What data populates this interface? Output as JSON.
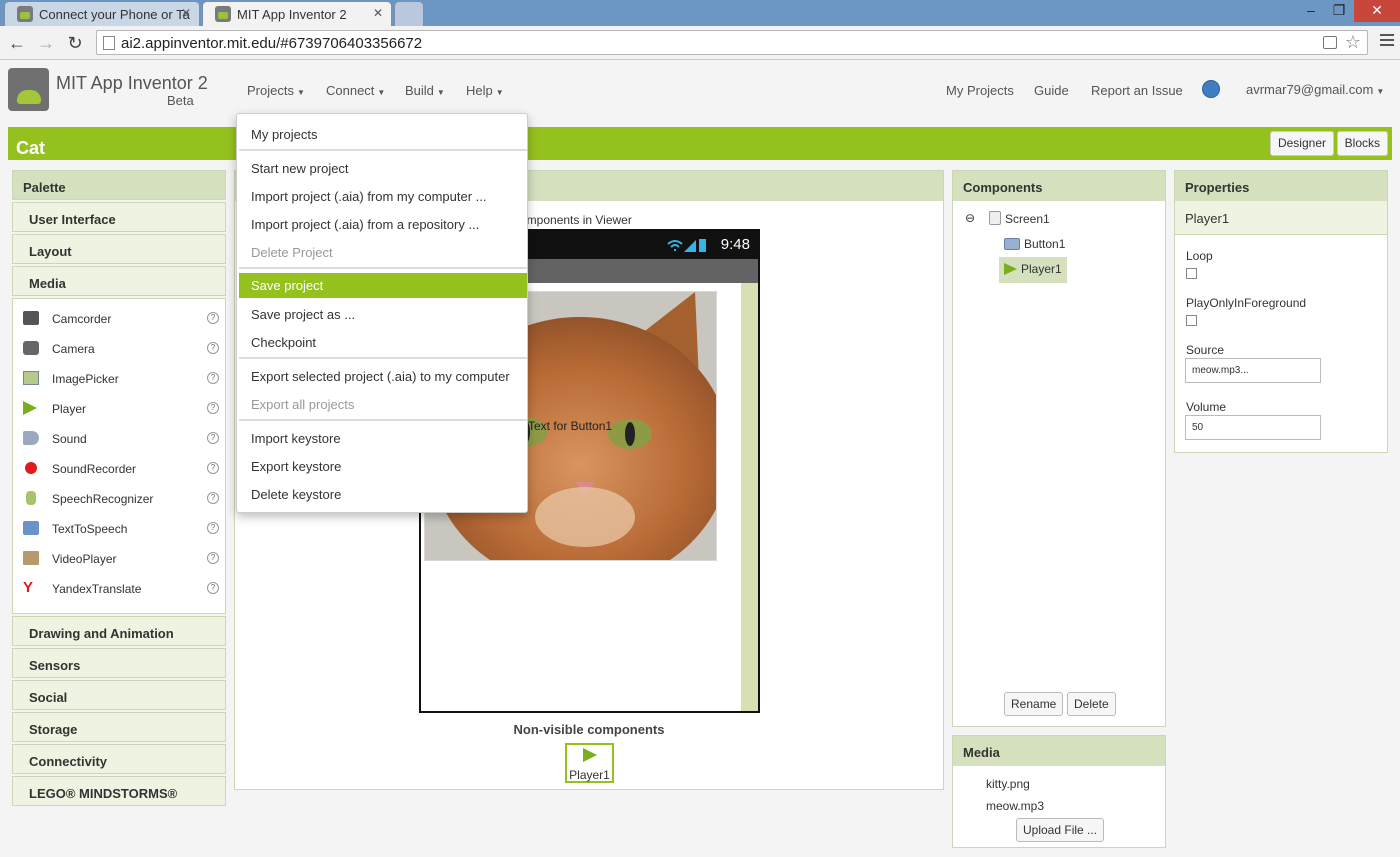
{
  "browser": {
    "tabs": [
      {
        "title": "Connect your Phone or Ta",
        "active": false
      },
      {
        "title": "MIT App Inventor 2",
        "active": true
      }
    ],
    "url": "ai2.appinventor.mit.edu/#6739706403356672"
  },
  "header": {
    "title": "MIT App Inventor 2",
    "subtitle": "Beta",
    "menus": [
      "Projects",
      "Connect",
      "Build",
      "Help"
    ],
    "links": [
      "My Projects",
      "Guide",
      "Report an Issue"
    ],
    "user": "avrmar79@gmail.com"
  },
  "project": {
    "name": "Cat",
    "designer_label": "Designer",
    "blocks_label": "Blocks"
  },
  "palette": {
    "title": "Palette",
    "categories_top": [
      "User Interface",
      "Layout",
      "Media"
    ],
    "media_items": [
      {
        "label": "Camcorder",
        "icon": "camcorder-icon"
      },
      {
        "label": "Camera",
        "icon": "camera-icon"
      },
      {
        "label": "ImagePicker",
        "icon": "imagepicker-icon"
      },
      {
        "label": "Player",
        "icon": "player-icon"
      },
      {
        "label": "Sound",
        "icon": "sound-icon"
      },
      {
        "label": "SoundRecorder",
        "icon": "soundrecorder-icon"
      },
      {
        "label": "SpeechRecognizer",
        "icon": "speechrecognizer-icon"
      },
      {
        "label": "TextToSpeech",
        "icon": "texttospeech-icon"
      },
      {
        "label": "VideoPlayer",
        "icon": "videoplayer-icon"
      },
      {
        "label": "YandexTranslate",
        "icon": "yandextranslate-icon"
      }
    ],
    "help_glyph": "?",
    "categories_bottom": [
      "Drawing and Animation",
      "Sensors",
      "Social",
      "Storage",
      "Connectivity",
      "LEGO® MINDSTORMS®"
    ]
  },
  "viewer": {
    "note": "omponents in Viewer",
    "phone_time": "9:48",
    "button_text": "Text for Button1",
    "nonvisible_title": "Non-visible components",
    "nonvisible_item": "Player1"
  },
  "components": {
    "title": "Components",
    "tree": [
      "Screen1",
      "Button1",
      "Player1"
    ],
    "collapse_glyph": "⊖",
    "rename_label": "Rename",
    "delete_label": "Delete"
  },
  "media": {
    "title": "Media",
    "files": [
      "kitty.png",
      "meow.mp3"
    ],
    "upload_label": "Upload File ..."
  },
  "properties": {
    "title": "Properties",
    "selected": "Player1",
    "loop_label": "Loop",
    "foreground_label": "PlayOnlyInForeground",
    "source_label": "Source",
    "source_value": "meow.mp3...",
    "volume_label": "Volume",
    "volume_value": "50"
  },
  "projects_menu": {
    "items": [
      {
        "label": "My projects",
        "state": "normal"
      },
      {
        "label": "Start new project",
        "state": "normal"
      },
      {
        "label": "Import project (.aia) from my computer ...",
        "state": "normal"
      },
      {
        "label": "Import project (.aia) from a repository ...",
        "state": "normal"
      },
      {
        "label": "Delete Project",
        "state": "disabled"
      },
      {
        "label": "Save project",
        "state": "active"
      },
      {
        "label": "Save project as ...",
        "state": "normal"
      },
      {
        "label": "Checkpoint",
        "state": "normal"
      },
      {
        "label": "Export selected project (.aia) to my computer",
        "state": "normal"
      },
      {
        "label": "Export all projects",
        "state": "disabled"
      },
      {
        "label": "Import keystore",
        "state": "normal"
      },
      {
        "label": "Export keystore",
        "state": "normal"
      },
      {
        "label": "Delete keystore",
        "state": "normal"
      }
    ]
  },
  "colors": {
    "accent": "#95c11f",
    "panel_header": "#d5e0bf"
  }
}
